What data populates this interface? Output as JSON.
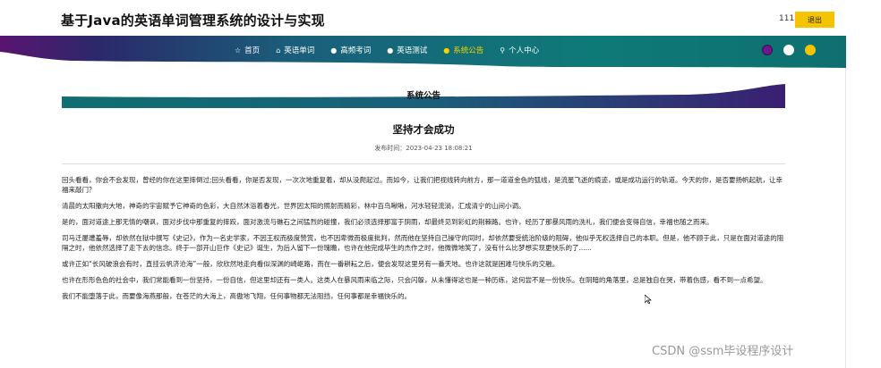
{
  "header": {
    "site_title": "基于Java的英语单词管理系统的设计与实现",
    "username": "111",
    "logout_label": "退出"
  },
  "nav": {
    "items": [
      {
        "icon": "home-icon",
        "glyph": "☆",
        "label": "首页",
        "active": false
      },
      {
        "icon": "book-icon",
        "glyph": "⌂",
        "label": "英语单词",
        "active": false
      },
      {
        "icon": "exam-icon",
        "glyph": "●",
        "label": "高频考词",
        "active": false
      },
      {
        "icon": "test-icon",
        "glyph": "●",
        "label": "英语测试",
        "active": false
      },
      {
        "icon": "notice-icon",
        "glyph": "●",
        "label": "系统公告",
        "active": true
      },
      {
        "icon": "user-icon",
        "glyph": "⚲",
        "label": "个人中心",
        "active": false
      }
    ],
    "theme_colors": [
      "#6b1a8c",
      "#ffffff",
      "#f5c400"
    ]
  },
  "section": {
    "title": "系统公告"
  },
  "article": {
    "title": "坚持才会成功",
    "publish_label": "发布时间：2023-04-23 18:08:21",
    "paragraphs": [
      "回头看看，你会不会发现，曾经的你在这里摔倒过;回头看看，你是否发现，一次次地重复着，却从没爬起过。而如今，让我们把视线转向前方，那一道道金色的弧线，是流星飞逝的痕迹，或是成功运行的轨道。今天的你，是否要扬帆起航，让幸福来敲门？",
      "清晨的太阳撒向大地，神奇的宇宙赋予它神奇的色彩，大自然沐浴着春光，世界因太阳的照射而精彩，林中百鸟啾啾，河水轻轻流淌，汇成清宁的山间小调。",
      "是的，面对道途上那无情的嘲讽，面对步伐中那重复的摔跤，面对激流与礁石之间猛烈的碰撞，我们必须选择那富于阴雨，却最终见到彩虹的荆棘路。也许，经历了那暴风雨的洗礼，我们便会变得自信，幸福也随之而来。",
      "司马迁屡遭羞辱，却依然在狱中撰写《史记》，作为一名史学家，不因王权而极度赞赏，也不因卑微而极度批判，然而他在坚持自己操守的同时，却依然要受统治阶级的阻碍，他似乎无权选择自己的本职。但是，他不顾于此，只是在面对道途的阻隔之时，他依然选择了走下去的信念。终于一部开山巨作《史记》诞生，为后人留下一份瑰瞻，也许在他完成毕生的杰作之时，他微微地笑了，没有什么比梦想实现更快乐的了......",
      "或许正如“长风破浪会有时，直挂云帆济沧海”一般，欣欣然地走向看似深渊的崎岖路，而在一番耕耘之后，便会发现这里另有一番天地。也许这就是困难与快乐的交融。",
      "也许在形形色色的社会中，我们常能看到一份坚持，一份自信，但这里却还有一类人。这类人在暴风雨来临之际，只会闪躲，从未懂得这也是一种历练，这何尝不是一份快乐。在阴暗的角落里，总是独自在哭，带着伤感，看不到一点希望。",
      "我们不能堕落于此，而要像海燕那般，在苍茫的大海上，高傲地飞翔，任何事物都无法阻挡，任何事都是幸福快乐的。"
    ]
  },
  "watermark": "CSDN @ssm毕设程序设计"
}
